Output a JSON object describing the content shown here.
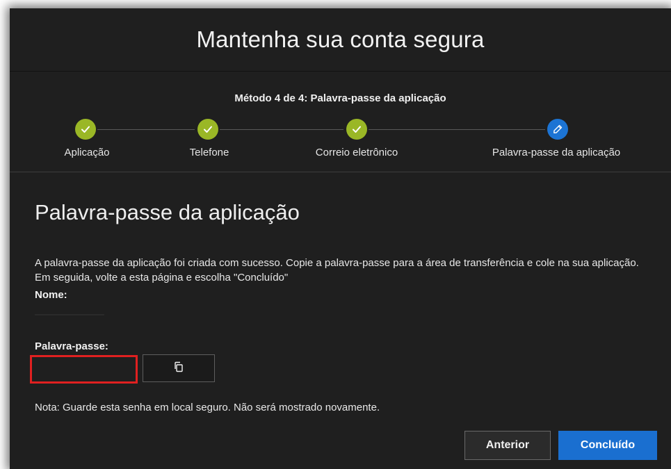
{
  "dialog": {
    "title": "Mantenha sua conta segura",
    "method_progress": "Método 4 de 4: Palavra-passe da aplicação"
  },
  "steps": [
    {
      "label": "Aplicação",
      "status": "done",
      "icon": "check-icon"
    },
    {
      "label": "Telefone",
      "status": "done",
      "icon": "check-icon"
    },
    {
      "label": "Correio eletrônico",
      "status": "done",
      "icon": "check-icon"
    },
    {
      "label": "Palavra-passe da aplicação",
      "status": "current",
      "icon": "pencil-icon"
    }
  ],
  "section": {
    "title": "Palavra-passe da aplicação",
    "description": "A palavra-passe da aplicação foi criada com sucesso. Copie a palavra-passe para a área de transferência e cole na sua aplicação. Em seguida, volte a esta página e escolha \"Concluído\"",
    "name_label": "Nome:",
    "password_label": "Palavra-passe:",
    "copy_icon": "copy-icon",
    "note": "Nota: Guarde esta senha em local seguro. Não será mostrado novamente."
  },
  "buttons": {
    "previous": "Anterior",
    "done": "Concluído"
  },
  "colors": {
    "step_done": "#9ab726",
    "step_current": "#1c74d4",
    "primary_button": "#1a6fd0",
    "highlight_border": "#e02020",
    "background": "#1f1f1f"
  }
}
